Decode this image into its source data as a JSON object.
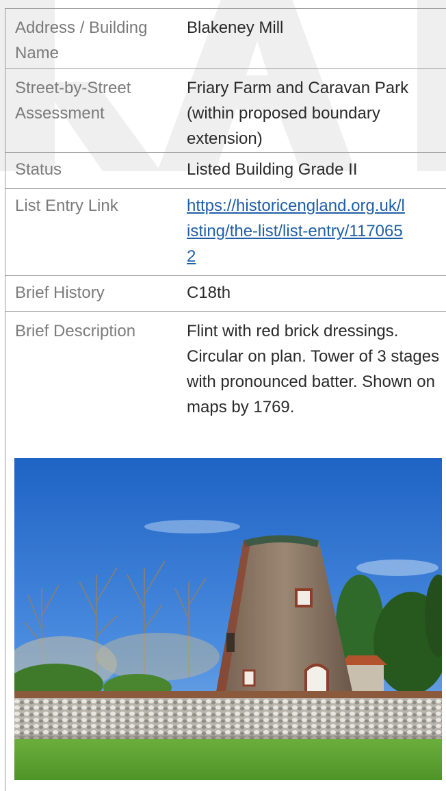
{
  "watermark": {
    "text": "DRAFT"
  },
  "record": {
    "rows": [
      {
        "label": "Address / Building Name",
        "value": "Blakeney Mill"
      },
      {
        "label": "Street-by-Street Assessment",
        "value": "Friary Farm and Caravan Park (within proposed boundary extension)"
      },
      {
        "label": "Status",
        "value": "Listed Building Grade II"
      },
      {
        "label": "List Entry Link",
        "value": "https://historicengland.org.uk/listing/the-list/list-entry/1170652"
      },
      {
        "label": "Brief History",
        "value": "C18th"
      },
      {
        "label": "Brief Description",
        "value": "Flint with red brick dressings. Circular on plan. Tower of 3 stages with pronounced batter. Shown on maps by 1769."
      }
    ]
  },
  "photo": {
    "subject": "tower windmill with flint wall and lawn"
  },
  "colors": {
    "label": "#7b7b7b",
    "value": "#2a2a2a",
    "link": "#1f5ea8",
    "rule": "#9a9a9a",
    "watermark": "#efefef"
  }
}
